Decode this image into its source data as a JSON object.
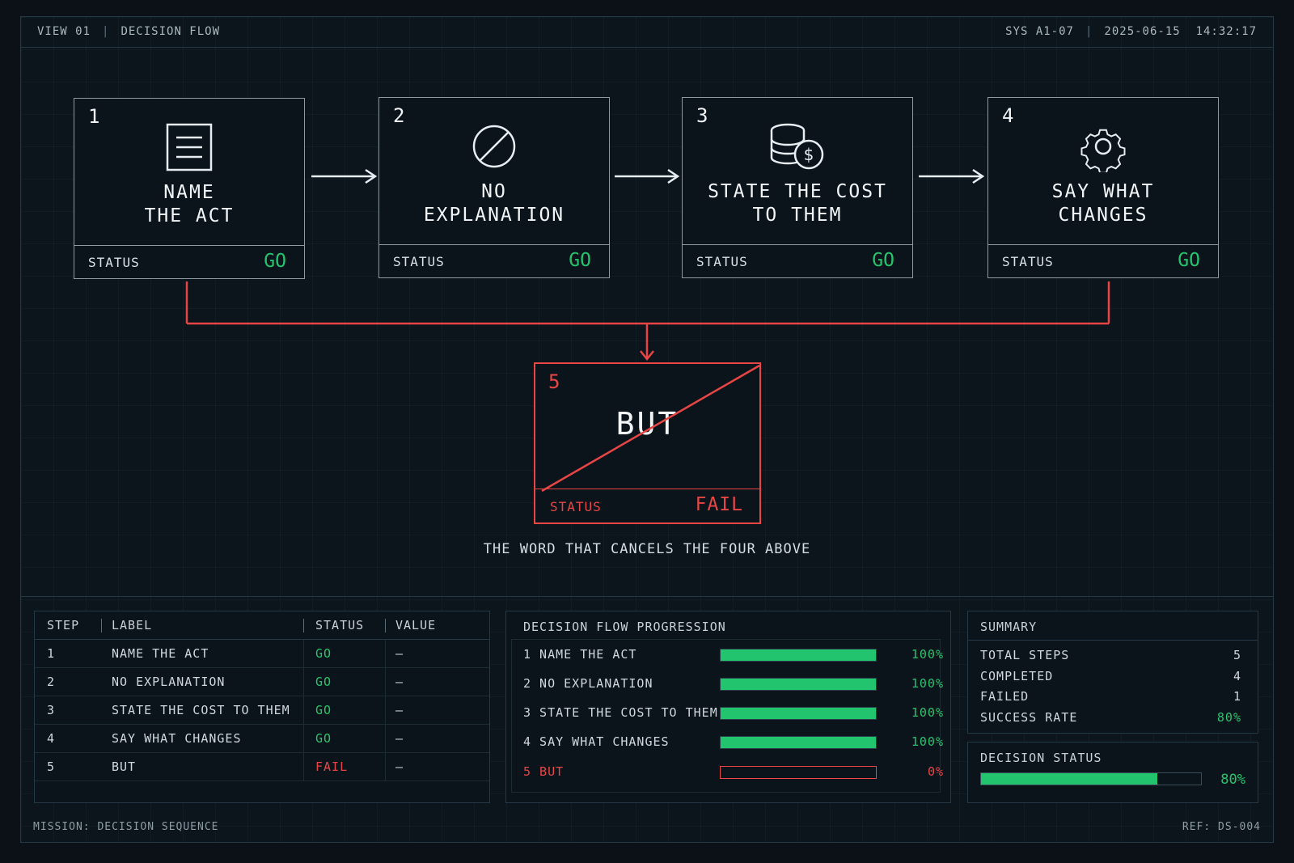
{
  "header": {
    "view": "VIEW 01",
    "section": "DECISION FLOW",
    "system": "SYS A1-07",
    "date": "2025-06-15",
    "time": "14:32:17"
  },
  "steps": [
    {
      "num": "1",
      "title_line1": "NAME",
      "title_line2": "THE ACT",
      "status_label": "STATUS",
      "status": "GO",
      "icon": "document-icon"
    },
    {
      "num": "2",
      "title_line1": "NO",
      "title_line2": "EXPLANATION",
      "status_label": "STATUS",
      "status": "GO",
      "icon": "prohibited-icon"
    },
    {
      "num": "3",
      "title_line1": "STATE THE COST",
      "title_line2": "TO THEM",
      "status_label": "STATUS",
      "status": "GO",
      "icon": "coins-dollar-icon"
    },
    {
      "num": "4",
      "title_line1": "SAY WHAT",
      "title_line2": "CHANGES",
      "status_label": "STATUS",
      "status": "GO",
      "icon": "gear-icon"
    }
  ],
  "fail_step": {
    "num": "5",
    "title": "BUT",
    "status_label": "STATUS",
    "status": "FAIL"
  },
  "caption": "THE WORD THAT CANCELS THE FOUR ABOVE",
  "table": {
    "headers": [
      "STEP",
      "LABEL",
      "STATUS",
      "VALUE"
    ],
    "rows": [
      {
        "step": "1",
        "label": "NAME THE ACT",
        "status": "GO",
        "value": "—"
      },
      {
        "step": "2",
        "label": "NO EXPLANATION",
        "status": "GO",
        "value": "—"
      },
      {
        "step": "3",
        "label": "STATE THE COST TO THEM",
        "status": "GO",
        "value": "—"
      },
      {
        "step": "4",
        "label": "SAY WHAT CHANGES",
        "status": "GO",
        "value": "—"
      },
      {
        "step": "5",
        "label": "BUT",
        "status": "FAIL",
        "value": "—"
      }
    ]
  },
  "progression": {
    "title": "DECISION FLOW PROGRESSION",
    "rows": [
      {
        "label": "1 NAME THE ACT",
        "percent": 100,
        "text": "100%"
      },
      {
        "label": "2 NO EXPLANATION",
        "percent": 100,
        "text": "100%"
      },
      {
        "label": "3 STATE THE COST TO THEM",
        "percent": 100,
        "text": "100%"
      },
      {
        "label": "4 SAY WHAT CHANGES",
        "percent": 100,
        "text": "100%"
      },
      {
        "label": "5 BUT",
        "percent": 0,
        "text": "0%"
      }
    ]
  },
  "summary": {
    "title": "SUMMARY",
    "rows": [
      {
        "label": "TOTAL STEPS",
        "value": "5"
      },
      {
        "label": "COMPLETED",
        "value": "4"
      },
      {
        "label": "FAILED",
        "value": "1"
      },
      {
        "label": "SUCCESS RATE",
        "value": "80%"
      }
    ]
  },
  "decision_status": {
    "title": "DECISION STATUS",
    "percent": 80,
    "text": "80%"
  },
  "footer": {
    "mission": "MISSION: DECISION SEQUENCE",
    "ref": "REF: DS-004"
  },
  "colors": {
    "go": "#22c56e",
    "fail": "#e84545",
    "background": "#0b1117",
    "border": "#253845"
  }
}
